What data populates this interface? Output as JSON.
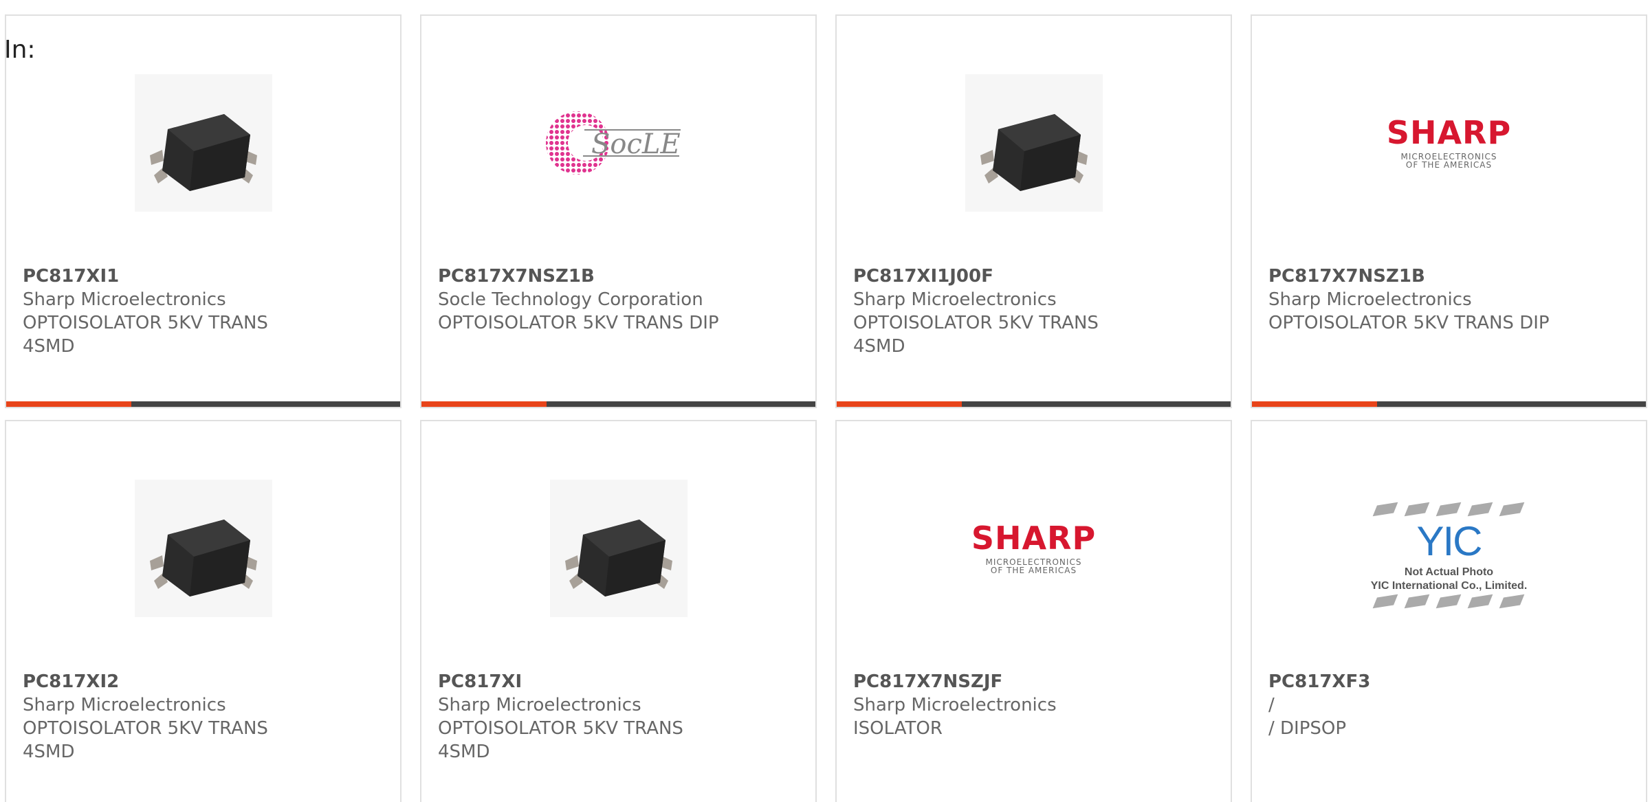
{
  "page": {
    "in_label": "In:"
  },
  "products": [
    {
      "part_number": "PC817XI1",
      "manufacturer": "Sharp Microelectronics",
      "description_lines": [
        "OPTOISOLATOR 5KV TRANS",
        "4SMD"
      ],
      "image": "optoisolator-chip-photo"
    },
    {
      "part_number": "PC817X7NSZ1B",
      "manufacturer": "Socle Technology Corporation",
      "description_lines": [
        "OPTOISOLATOR 5KV TRANS DIP"
      ],
      "image": "socle-logo",
      "logo_text": "SocLE"
    },
    {
      "part_number": "PC817XI1J00F",
      "manufacturer": "Sharp Microelectronics",
      "description_lines": [
        "OPTOISOLATOR 5KV TRANS",
        "4SMD"
      ],
      "image": "optoisolator-chip-photo"
    },
    {
      "part_number": "PC817X7NSZ1B",
      "manufacturer": "Sharp Microelectronics",
      "description_lines": [
        "OPTOISOLATOR 5KV TRANS DIP"
      ],
      "image": "sharp-logo",
      "logo_text": "SHARP",
      "logo_sub_1": "MICROELECTRONICS",
      "logo_sub_2": "OF THE AMERICAS"
    },
    {
      "part_number": "PC817XI2",
      "manufacturer": "Sharp Microelectronics",
      "description_lines": [
        "OPTOISOLATOR 5KV TRANS",
        "4SMD"
      ],
      "image": "optoisolator-chip-photo"
    },
    {
      "part_number": "PC817XI",
      "manufacturer": "Sharp Microelectronics",
      "description_lines": [
        "OPTOISOLATOR 5KV TRANS",
        "4SMD"
      ],
      "image": "optoisolator-chip-photo"
    },
    {
      "part_number": "PC817X7NSZJF",
      "manufacturer": "Sharp Microelectronics",
      "description_lines": [
        "ISOLATOR"
      ],
      "image": "sharp-logo",
      "logo_text": "SHARP",
      "logo_sub_1": "MICROELECTRONICS",
      "logo_sub_2": "OF THE AMERICAS"
    },
    {
      "part_number": "PC817XF3",
      "manufacturer": "/",
      "description_lines": [
        "/ DIPSOP"
      ],
      "image": "yic-not-actual-photo",
      "logo_text": "YIC",
      "logo_sub_1": "Not Actual Photo",
      "logo_sub_2": "YIC International Co., Limited."
    }
  ],
  "colors": {
    "accent": "#e8441a",
    "bar": "#444444",
    "sharp_red": "#d7172f",
    "socle_pink": "#e0338f",
    "yic_blue": "#2a78c5"
  }
}
